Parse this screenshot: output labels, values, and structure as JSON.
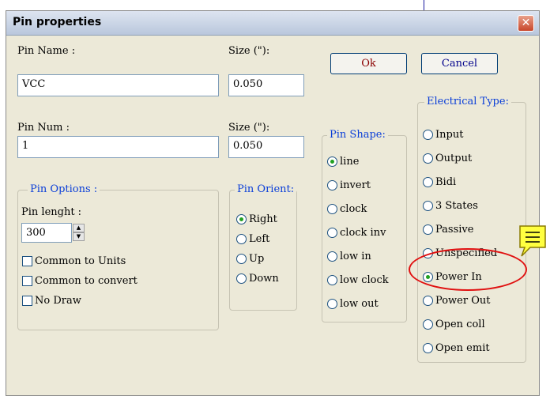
{
  "dialog": {
    "title": "Pin properties",
    "close_label": "✕"
  },
  "pin_name": {
    "label": "Pin Name :",
    "value": "VCC"
  },
  "pin_name_size": {
    "label": "Size (\"):",
    "value": "0.050"
  },
  "pin_num": {
    "label": "Pin Num :",
    "value": "1"
  },
  "pin_num_size": {
    "label": "Size (\"):",
    "value": "0.050"
  },
  "buttons": {
    "ok": "Ok",
    "cancel": "Cancel"
  },
  "pin_options": {
    "legend": "Pin Options :",
    "length_label": "Pin lenght :",
    "length_value": "300",
    "common_units": "Common to Units",
    "common_convert": "Common to convert",
    "no_draw": "No Draw"
  },
  "pin_orient": {
    "legend": "Pin Orient:",
    "options": [
      "Right",
      "Left",
      "Up",
      "Down"
    ],
    "selected": "Right"
  },
  "pin_shape": {
    "legend": "Pin Shape:",
    "options": [
      "line",
      "invert",
      "clock",
      "clock inv",
      "low in",
      "low clock",
      "low out"
    ],
    "selected": "line"
  },
  "electrical_type": {
    "legend": "Electrical Type:",
    "options": [
      "Input",
      "Output",
      "Bidi",
      "3 States",
      "Passive",
      "Unspecified",
      "Power In",
      "Power Out",
      "Open coll",
      "Open emit"
    ],
    "selected": "Power In"
  },
  "colors": {
    "legend_text": "#0a3ed8",
    "highlight_ellipse": "#e01010",
    "note_icon": "#ffff40"
  }
}
